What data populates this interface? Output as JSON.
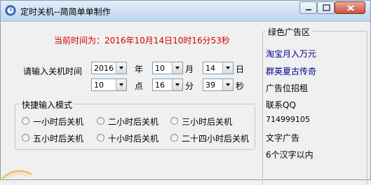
{
  "window": {
    "title": "定时关机--简简单单制作"
  },
  "current_time": {
    "text": "当前时间为：2016年10月14日10时16分53秒"
  },
  "shutdown_time": {
    "label": "请输入关机时间",
    "year": {
      "value": "2016",
      "unit": "年"
    },
    "month": {
      "value": "10",
      "unit": "月"
    },
    "day": {
      "value": "14",
      "unit": "日"
    },
    "hour": {
      "value": "10",
      "unit": "点"
    },
    "minute": {
      "value": "16",
      "unit": "分"
    },
    "second": {
      "value": "39",
      "unit": "秒"
    }
  },
  "quick_mode": {
    "legend": "快捷输入模式",
    "options": [
      {
        "label": "一小时后关机",
        "selected": false
      },
      {
        "label": "二小时后关机",
        "selected": false
      },
      {
        "label": "三小时后关机",
        "selected": false
      },
      {
        "label": "五小时后关机",
        "selected": false
      },
      {
        "label": "十小时后关机",
        "selected": false
      },
      {
        "label": "二十四小时后关机",
        "selected": false
      }
    ]
  },
  "ad_panel": {
    "legend": "绿色广告区",
    "items": [
      "淘宝月入万元",
      "群英夏古传奇",
      "广告位招租",
      "联系QQ",
      "714999105",
      "文字广告",
      "6个汉字以内"
    ],
    "link_color": "#00008b"
  },
  "colors": {
    "current_time": "#d40000",
    "titlebar": "#cfe0f3",
    "close_button": "#c9503a"
  }
}
